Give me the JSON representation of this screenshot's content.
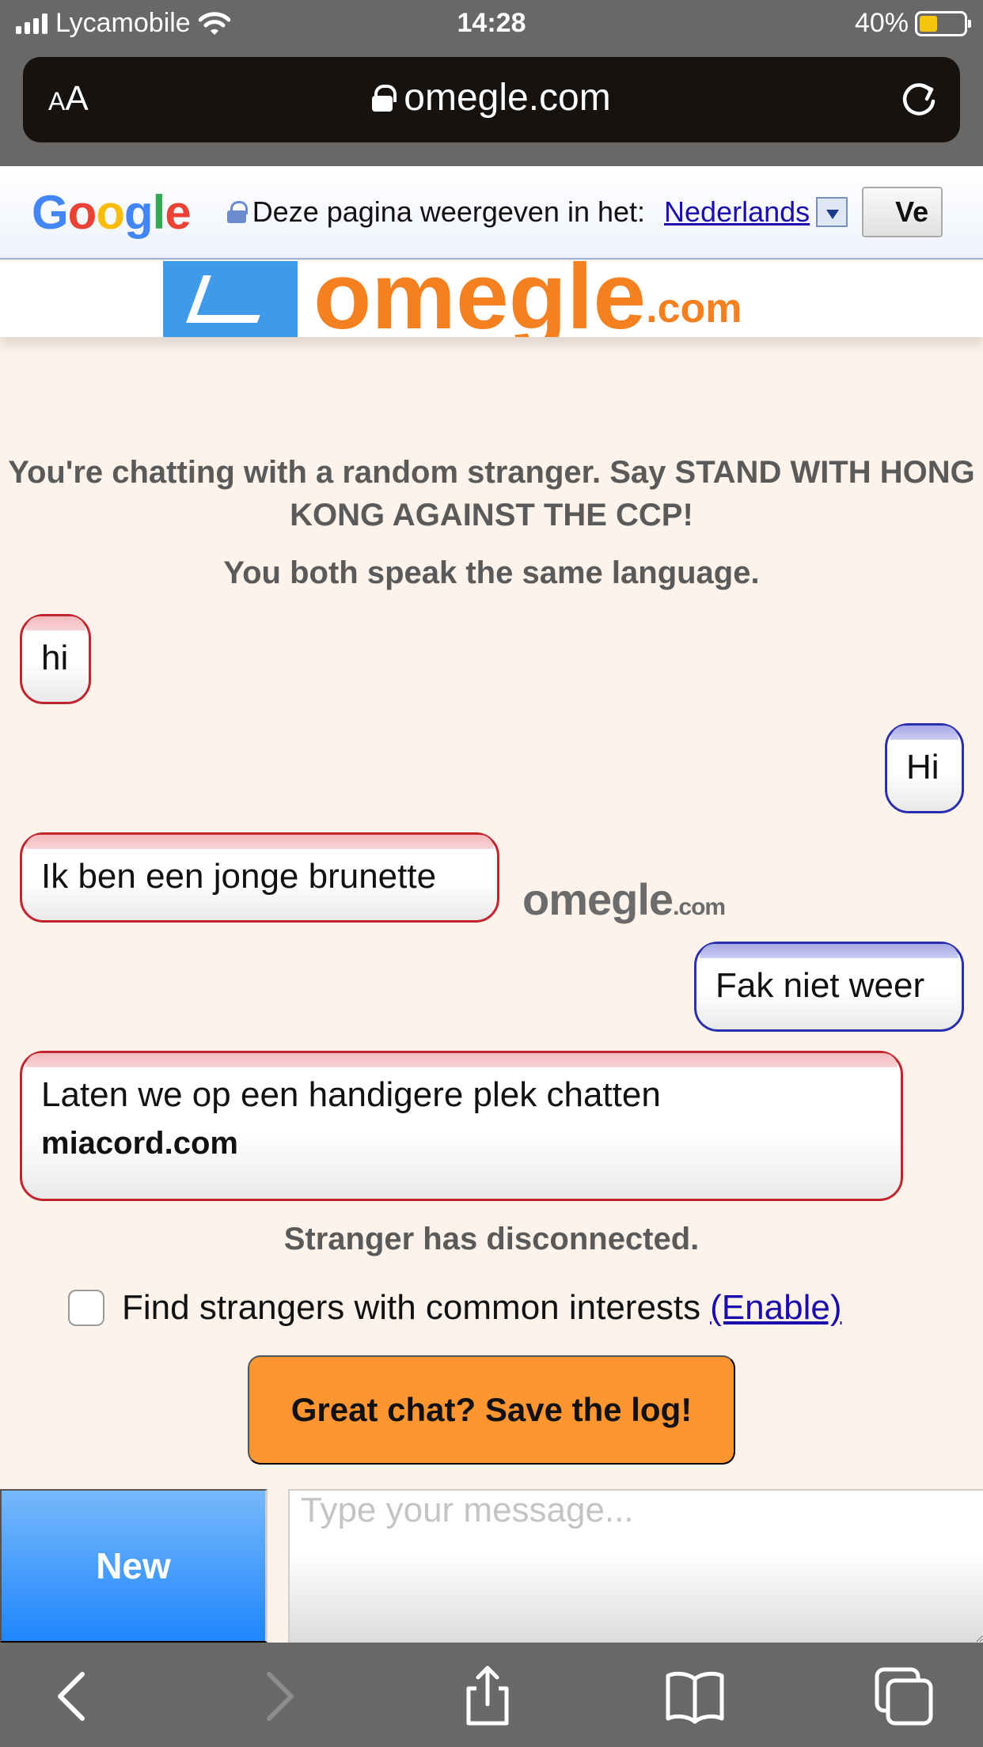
{
  "status_bar": {
    "carrier": "Lycamobile",
    "time": "14:28",
    "battery": "40%",
    "battery_level": 0.4
  },
  "browser": {
    "text_size_label_small": "A",
    "text_size_label_large": "A",
    "url": "omegle.com"
  },
  "translate_bar": {
    "logo": "Google",
    "prompt": "Deze pagina weergeven in het:",
    "language": "Nederlands",
    "button_label": "Ve"
  },
  "site": {
    "logo_text": "omegle",
    "logo_suffix": ".com"
  },
  "chat": {
    "intro": "You're chatting with a random stranger. Say STAND WITH HONG KONG AGAINST THE CCP!",
    "language_note": "You both speak the same language.",
    "messages": [
      {
        "from": "stranger",
        "text": "hi"
      },
      {
        "from": "you",
        "text": "Hi"
      },
      {
        "from": "stranger",
        "text": "Ik ben een jonge brunette"
      },
      {
        "from": "you",
        "text": "Fak niet weer"
      },
      {
        "from": "stranger",
        "text": "Laten we op een handigere plek chatten",
        "link": "miacord.com"
      }
    ],
    "watermark": "omegle",
    "watermark_suffix": ".com",
    "disconnected": "Stranger has disconnected.",
    "interests_label": "Find strangers with common interests",
    "interests_link": "(Enable)",
    "save_log_label": "Great chat? Save the log!",
    "new_label": "New",
    "input_placeholder": "Type your message..."
  },
  "icons": {
    "signal": "signal-icon",
    "wifi": "wifi-icon",
    "battery": "battery-icon",
    "lock": "lock-icon",
    "reload": "reload-icon",
    "back": "chevron-left-icon",
    "forward": "chevron-right-icon",
    "share": "share-icon",
    "bookmarks": "book-icon",
    "tabs": "tabs-icon"
  },
  "colors": {
    "page_bg": "#fdf3ea",
    "stranger_border": "#c0242d",
    "you_border": "#2a2fb0",
    "save_button": "#fd9531",
    "new_button": "#1f86fb",
    "battery_fill": "#f5c40f"
  }
}
